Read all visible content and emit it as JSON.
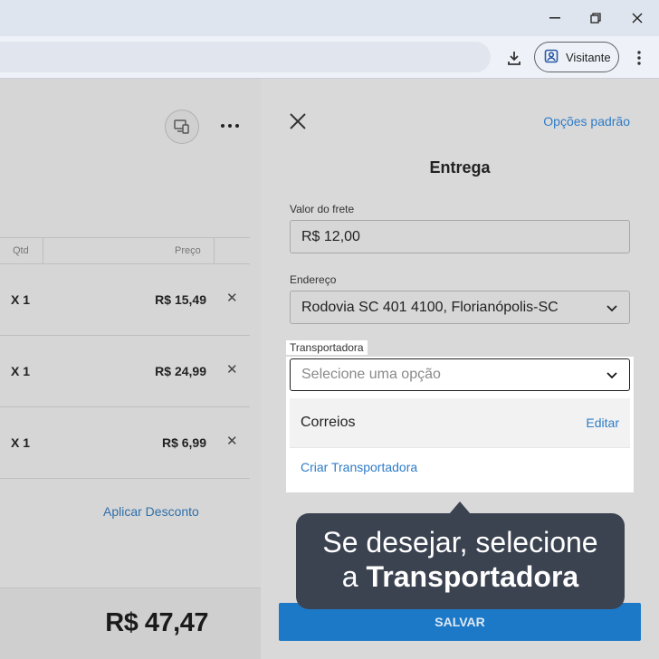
{
  "browser": {
    "profile_label": "Visitante",
    "window_controls": [
      "minimize",
      "restore",
      "close"
    ],
    "icons": [
      "download-icon",
      "profile-icon",
      "kebab-menu-icon"
    ]
  },
  "order": {
    "header": {
      "qty_label": "Qtd",
      "price_label": "Preço"
    },
    "items": [
      {
        "qty": "X 1",
        "price": "R$ 15,49"
      },
      {
        "qty": "X 1",
        "price": "R$ 24,99"
      },
      {
        "qty": "X 1",
        "price": "R$ 6,99"
      }
    ],
    "discount_link": "Aplicar Desconto",
    "total": "R$ 47,47"
  },
  "panel": {
    "defaults_link": "Opções padrão",
    "title": "Entrega",
    "freight_label": "Valor do frete",
    "freight_value": "R$ 12,00",
    "address_label": "Endereço",
    "address_value": "Rodovia SC 401 4100, Florianópolis-SC",
    "carrier_label": "Transportadora",
    "carrier_placeholder": "Selecione uma opção",
    "carrier_options": [
      {
        "name": "Correios",
        "action": "Editar"
      }
    ],
    "create_carrier": "Criar Transportadora",
    "save_button": "SALVAR"
  },
  "tooltip": {
    "line1": "Se desejar, selecione",
    "line2_prefix": "a",
    "line2_bold": "Transportadora"
  },
  "colors": {
    "accent": "#2e7cc7",
    "save_button": "#1c79c8",
    "tooltip_bg": "#3b4351"
  }
}
